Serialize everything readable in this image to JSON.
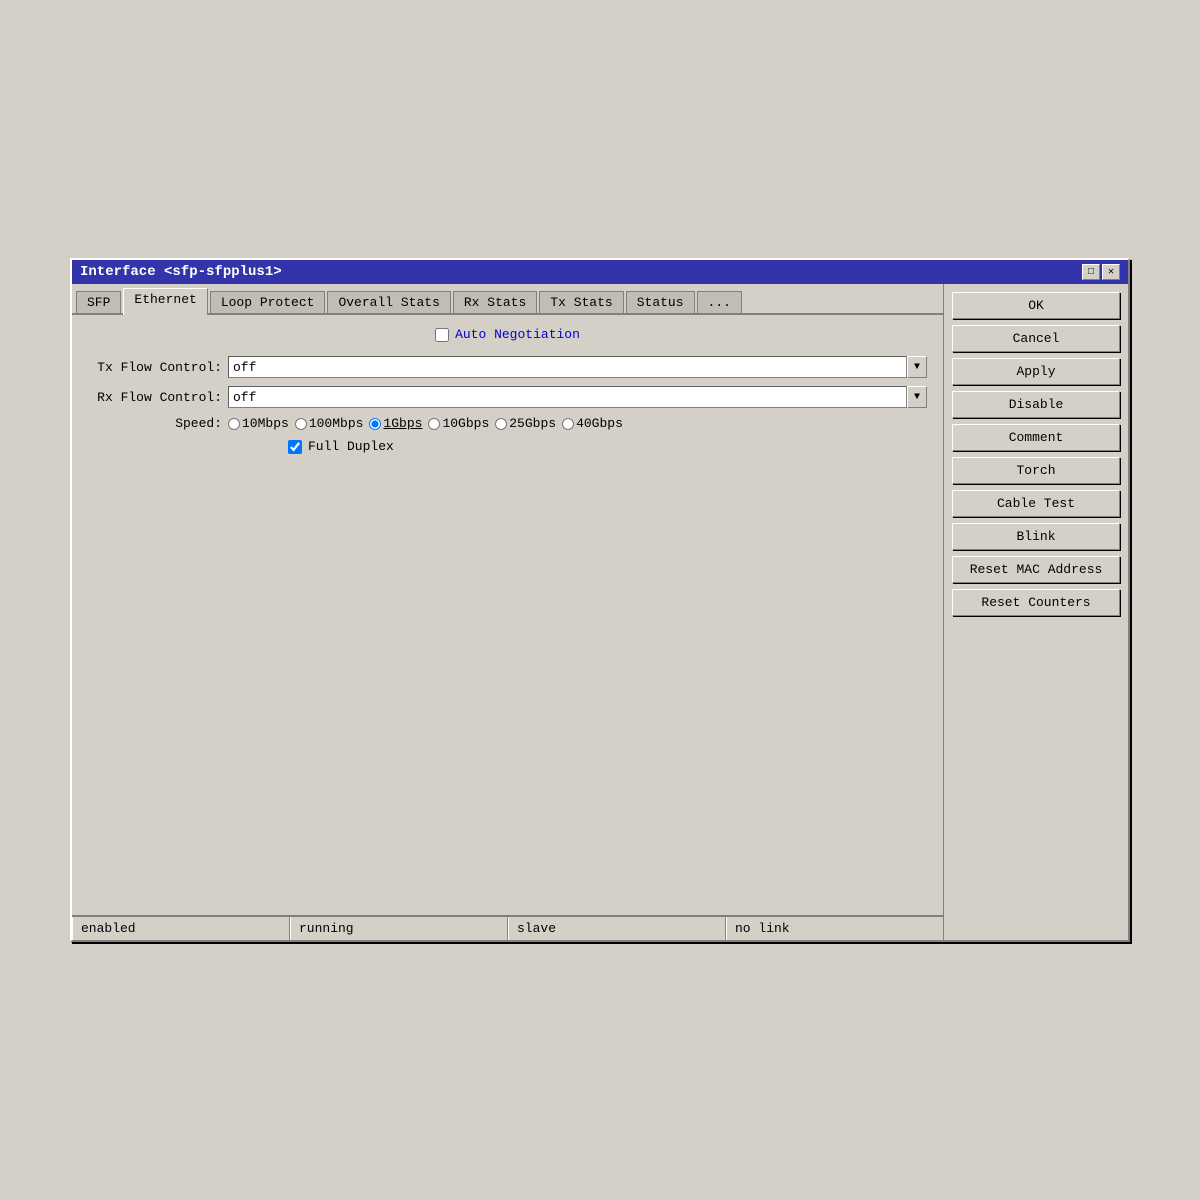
{
  "window": {
    "title": "Interface <sfp-sfpplus1>",
    "minimize_label": "□",
    "close_label": "✕"
  },
  "tabs": [
    {
      "label": "SFP",
      "active": false
    },
    {
      "label": "Ethernet",
      "active": true
    },
    {
      "label": "Loop Protect",
      "active": false
    },
    {
      "label": "Overall Stats",
      "active": false
    },
    {
      "label": "Rx Stats",
      "active": false
    },
    {
      "label": "Tx Stats",
      "active": false
    },
    {
      "label": "Status",
      "active": false
    },
    {
      "label": "...",
      "active": false
    }
  ],
  "form": {
    "auto_negotiation_label": "Auto Negotiation",
    "tx_flow_label": "Tx Flow Control:",
    "tx_flow_value": "off",
    "rx_flow_label": "Rx Flow Control:",
    "rx_flow_value": "off",
    "speed_label": "Speed:",
    "speed_options": [
      "10Mbps",
      "100Mbps",
      "1Gbps",
      "10Gbps",
      "25Gbps",
      "40Gbps"
    ],
    "selected_speed": "1Gbps",
    "full_duplex_label": "Full Duplex",
    "full_duplex_checked": true,
    "auto_negotiation_checked": false
  },
  "buttons": {
    "ok": "OK",
    "cancel": "Cancel",
    "apply": "Apply",
    "disable": "Disable",
    "comment": "Comment",
    "torch": "Torch",
    "cable_test": "Cable Test",
    "blink": "Blink",
    "reset_mac": "Reset MAC Address",
    "reset_counters": "Reset Counters"
  },
  "status_bar": {
    "enabled": "enabled",
    "running": "running",
    "slave": "slave",
    "no_link": "no link"
  },
  "dropdown_arrow": "▼"
}
